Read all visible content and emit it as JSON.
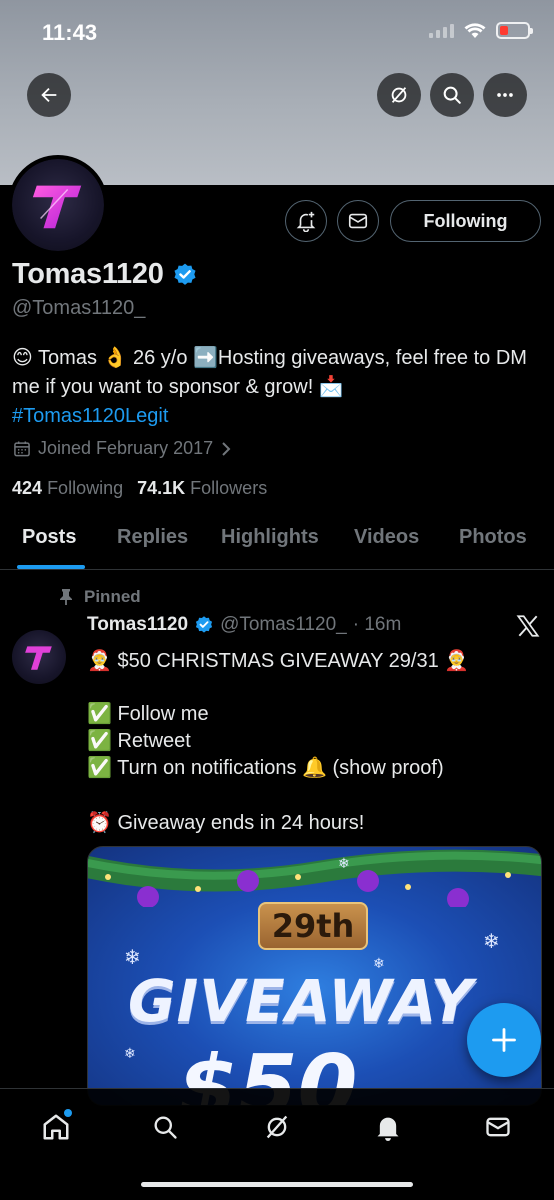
{
  "status_bar": {
    "time": "11:43"
  },
  "profile": {
    "display_name": "Tomas1120",
    "handle": "@Tomas1120_",
    "verified": true,
    "bio_prefix": "😊 Tomas 👌 26 y/o ➡️Hosting giveaways, feel free to DM me if you want to sponsor & grow! 📩",
    "bio_hashtag": "#Tomas1120Legit",
    "joined": "Joined February 2017",
    "following_count": "424",
    "following_label": "Following",
    "followers_count": "74.1K",
    "followers_label": "Followers",
    "following_button": "Following"
  },
  "tabs": [
    {
      "label": "Posts",
      "active": true
    },
    {
      "label": "Replies",
      "active": false
    },
    {
      "label": "Highlights",
      "active": false
    },
    {
      "label": "Videos",
      "active": false
    },
    {
      "label": "Photos",
      "active": false
    }
  ],
  "tweet": {
    "pinned_label": "Pinned",
    "author_name": "Tomas1120",
    "author_handle": "@Tomas1120_",
    "time": "· 16m",
    "lines": [
      "🤶 $50 CHRISTMAS GIVEAWAY 29/31 🤶",
      "✅ Follow me",
      "✅ Retweet",
      "✅ Turn on notifications 🔔 (show proof)",
      "⏰ Giveaway ends in 24 hours!"
    ],
    "media": {
      "badge": "29th",
      "headline": "GIVEAWAY",
      "amount": "$50"
    }
  },
  "colors": {
    "accent": "#1d9bf0",
    "background": "#000000",
    "secondary_text": "#71767b"
  },
  "icons": {
    "back": "arrow-left-icon",
    "grok": "grok-icon",
    "search": "search-icon",
    "more": "more-icon",
    "notify": "bell-plus-icon",
    "message": "mail-icon",
    "verified": "verified-badge-icon",
    "calendar": "calendar-icon",
    "pin": "pin-icon",
    "x": "x-logo-icon",
    "compose": "plus-icon"
  }
}
